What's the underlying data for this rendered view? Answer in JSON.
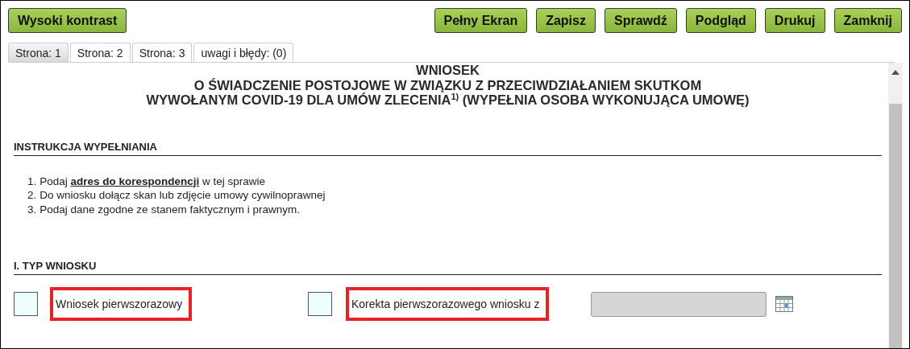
{
  "toolbar": {
    "left_buttons": [
      "Wysoki kontrast"
    ],
    "right_buttons": [
      "Pełny Ekran",
      "Zapisz",
      "Sprawdź",
      "Podgląd",
      "Drukuj",
      "Zamknij"
    ]
  },
  "tabs": [
    {
      "label": "Strona: 1",
      "selected": true
    },
    {
      "label": "Strona: 2",
      "selected": false
    },
    {
      "label": "Strona: 3",
      "selected": false
    },
    {
      "label": "uwagi i błędy: (0)",
      "selected": false
    }
  ],
  "form": {
    "title_lines": [
      "WNIOSEK",
      "O ŚWIADCZENIE POSTOJOWE W ZWIĄZKU Z PRZECIWDZIAŁANIEM SKUTKOM",
      "WYWOŁANYM COVID-19 DLA UMÓW ZLECENIA$^{1)}$ (WYPEŁNIA OSOBA WYKONUJĄCA UMOWĘ)"
    ],
    "sections": [
      {
        "kind": "instructions",
        "heading": "INSTRUKCJA WYPEŁNIANIA",
        "items": [
          {
            "number": "1.",
            "text": "Podaj **adres do korespondencji** w tej sprawie"
          },
          {
            "number": "2.",
            "text": "Do wniosku dołącz skan lub zdjęcie umowy cywilnoprawnej"
          },
          {
            "number": "3.",
            "text": "Podaj dane zgodne ze stanem faktycznym i prawnym."
          }
        ]
      },
      {
        "kind": "choices",
        "heading": "I. TYP WNIOSKU",
        "options": [
          {
            "label": "Wniosek pierwszorazowy",
            "checked": false,
            "highlighted": true
          },
          {
            "label": "Korekta pierwszorazowego wniosku z",
            "checked": false,
            "highlighted": true,
            "date_field": {
              "disabled": true
            }
          }
        ]
      }
    ]
  }
}
